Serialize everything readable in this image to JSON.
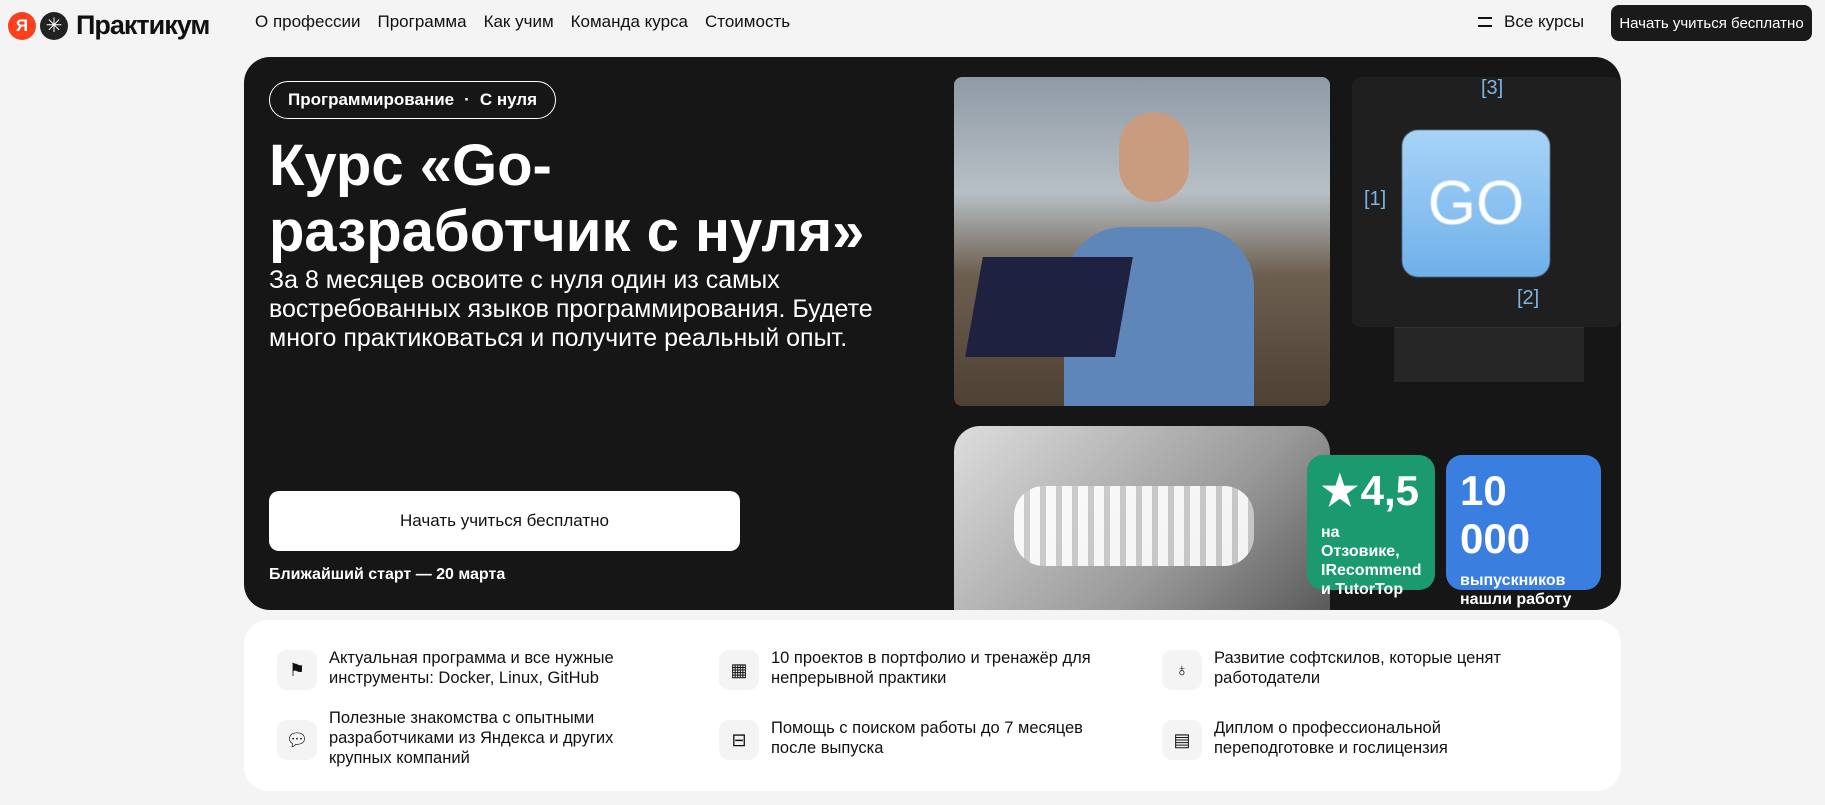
{
  "header": {
    "logo_mark": "Я",
    "logo_text": "Практикум",
    "nav": [
      "О профессии",
      "Программа",
      "Как учим",
      "Команда курса",
      "Стоимость"
    ],
    "all_courses": "Все курсы",
    "cta": "Начать учиться бесплатно"
  },
  "hero": {
    "chip_category": "Программирование",
    "chip_level": "С нуля",
    "title": "Курс «Go-разработчик с нуля»",
    "subtitle": "За 8 месяцев освоите с нуля один из самых востребованных языков программирования. Будете много практиковаться и получите реальный опыт.",
    "cta": "Начать учиться бесплатно",
    "next_start": "Ближайший старт — 20 марта",
    "graphic": {
      "key": "GO",
      "label1": "[1]",
      "label2": "[2]",
      "label3": "[3]"
    },
    "rating": {
      "value": "4,5",
      "text": "на Отзовике, IRecommend и TutorTop",
      "color": "#1b9a70"
    },
    "graduates": {
      "value": "10 000",
      "text": "выпускников нашли работу после обучения",
      "color": "#3a7ee0"
    }
  },
  "features": [
    {
      "icon": "flag-icon",
      "text": "Актуальная программа и все нужные инструменты: Docker, Linux, GitHub"
    },
    {
      "icon": "grid-icon",
      "text": "10 проектов в портфолио и тренажёр для непрерывной практики"
    },
    {
      "icon": "lightbulb-icon",
      "text": "Развитие софтскилов, которые ценят работодатели"
    },
    {
      "icon": "chat-icon",
      "text": "Полезные знакомства с опытными разработчиками из Яндекса и других крупных компаний"
    },
    {
      "icon": "briefcase-icon",
      "text": "Помощь с поиском работы до 7 месяцев после выпуска"
    },
    {
      "icon": "diploma-icon",
      "text": "Диплом о профессиональной переподготовке и гослицензия"
    }
  ]
}
